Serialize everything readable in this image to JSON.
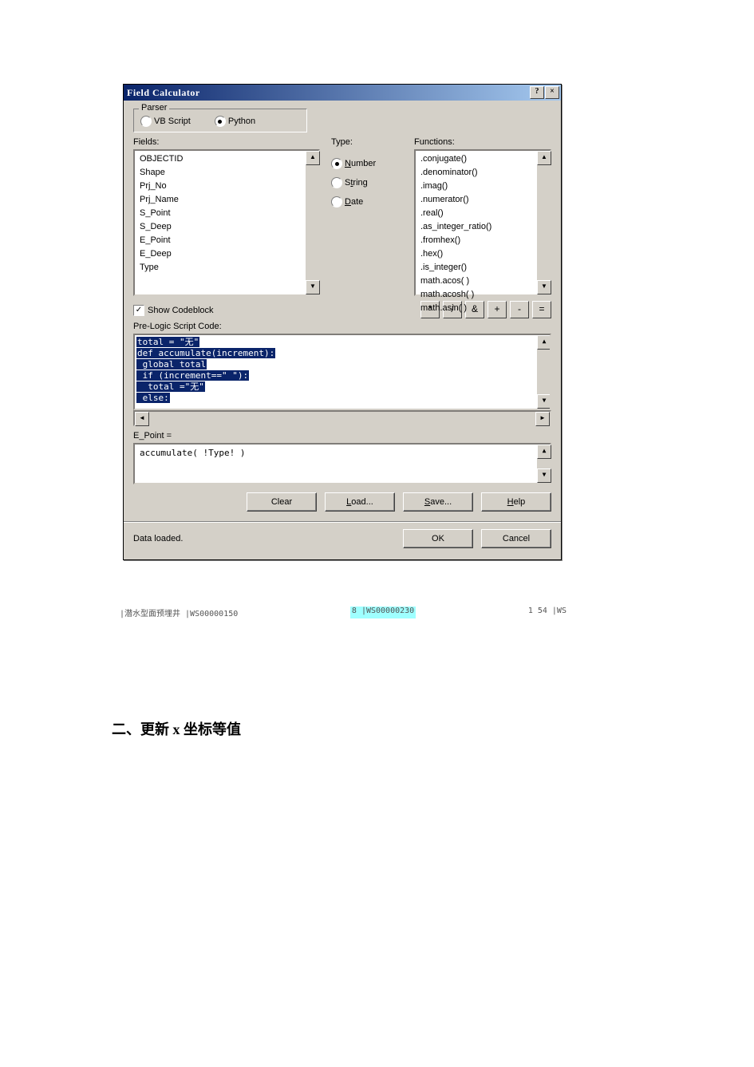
{
  "window": {
    "title": "Field Calculator",
    "help_btn": "?",
    "close_btn": "×"
  },
  "parser": {
    "legend": "Parser",
    "vb_label": "VB Script",
    "py_label": "Python",
    "selected": "Python"
  },
  "fields": {
    "label": "Fields:",
    "items": [
      "OBJECTID",
      "Shape",
      "Prj_No",
      "Prj_Name",
      "S_Point",
      "S_Deep",
      "E_Point",
      "E_Deep",
      "Type"
    ]
  },
  "type": {
    "label": "Type:",
    "number": "Number",
    "string": "String",
    "date": "Date",
    "selected": "Number"
  },
  "functions": {
    "label": "Functions:",
    "items": [
      ".conjugate()",
      ".denominator()",
      ".imag()",
      ".numerator()",
      ".real()",
      ".as_integer_ratio()",
      ".fromhex()",
      ".hex()",
      ".is_integer()",
      "math.acos( )",
      "math.acosh( )",
      "math.asin( )"
    ]
  },
  "show_codeblock": {
    "label": "Show Codeblock",
    "checked": true
  },
  "operators": [
    "*",
    "/",
    "&",
    "+",
    "-",
    "="
  ],
  "prelogic": {
    "label": "Pre-Logic Script Code:",
    "lines": [
      "total = \"无\"",
      "def accumulate(increment):",
      " global total",
      " if (increment==\" \"):",
      "  total =\"无\"",
      " else:"
    ]
  },
  "expression": {
    "label": "E_Point =",
    "value": "accumulate( !Type! )"
  },
  "buttons": {
    "clear": "Clear",
    "load": "Load...",
    "save": "Save...",
    "help": "Help",
    "ok": "OK",
    "cancel": "Cancel"
  },
  "status": "Data loaded.",
  "below_fragments": {
    "left": "|潜水型面预埋井  |WS00000150",
    "mid": "8 |WS00000230",
    "right": "1  54 |WS"
  },
  "doc_heading": "二、更新 x 坐标等值"
}
